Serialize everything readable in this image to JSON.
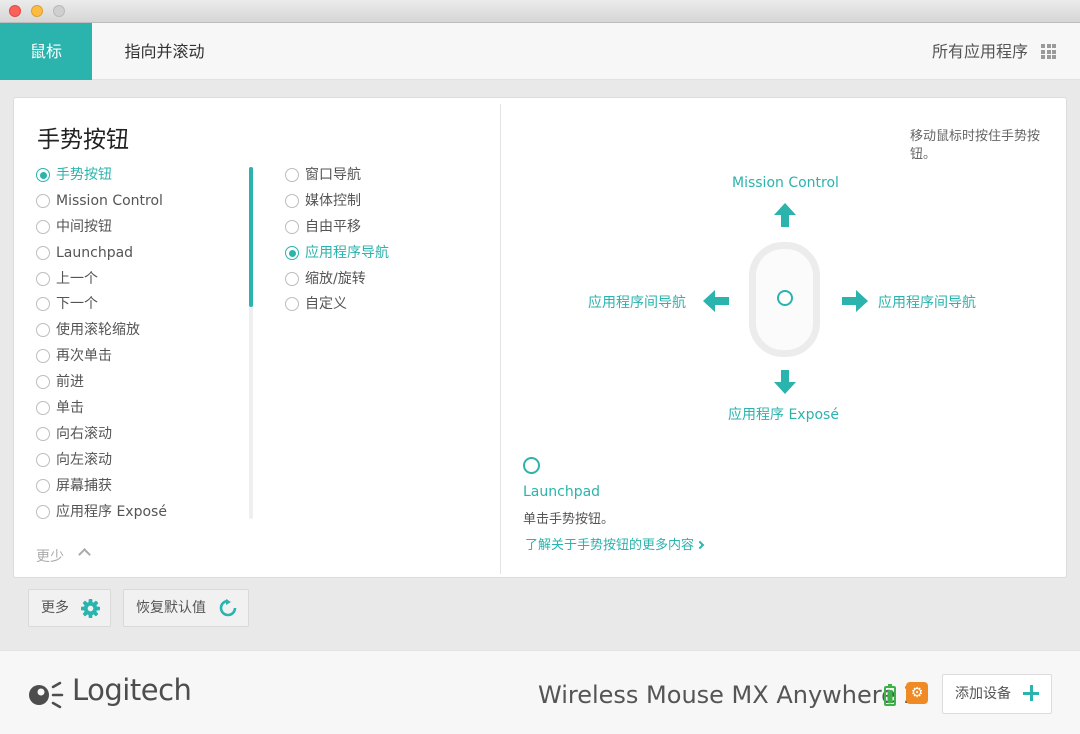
{
  "tabs": [
    {
      "label": "鼠标",
      "active": true
    },
    {
      "label": "指向并滚动",
      "active": false
    }
  ],
  "all_apps_label": "所有应用程序",
  "section_title": "手势按钮",
  "options_col1": [
    {
      "label": "手势按钮",
      "selected": true
    },
    {
      "label": "Mission Control",
      "selected": false
    },
    {
      "label": "中间按钮",
      "selected": false
    },
    {
      "label": "Launchpad",
      "selected": false
    },
    {
      "label": "上一个",
      "selected": false
    },
    {
      "label": "下一个",
      "selected": false
    },
    {
      "label": "使用滚轮缩放",
      "selected": false
    },
    {
      "label": "再次单击",
      "selected": false
    },
    {
      "label": "前进",
      "selected": false
    },
    {
      "label": "单击",
      "selected": false
    },
    {
      "label": "向右滚动",
      "selected": false
    },
    {
      "label": "向左滚动",
      "selected": false
    },
    {
      "label": "屏幕捕获",
      "selected": false
    },
    {
      "label": "应用程序 Exposé",
      "selected": false
    }
  ],
  "options_col2": [
    {
      "label": "窗口导航",
      "selected": false
    },
    {
      "label": "媒体控制",
      "selected": false
    },
    {
      "label": "自由平移",
      "selected": false
    },
    {
      "label": "应用程序导航",
      "selected": true
    },
    {
      "label": "缩放/旋转",
      "selected": false
    },
    {
      "label": "自定义",
      "selected": false
    }
  ],
  "fewer_label": "更少",
  "hint": "移动鼠标时按住手势按钮。",
  "diagram": {
    "up": "Mission Control",
    "left": "应用程序间导航",
    "right": "应用程序间导航",
    "down": "应用程序 Exposé"
  },
  "click_action": {
    "title": "Launchpad",
    "desc": "单击手势按钮。",
    "link": "了解关于手势按钮的更多内容"
  },
  "more_button": "更多",
  "restore_button": "恢复默认值",
  "footer": {
    "brand": "Logitech",
    "device_name": "Wireless Mouse MX Anywhere 2",
    "add_device": "添加设备"
  },
  "icons": {
    "more": "gear-icon",
    "restore": "refresh-icon",
    "apps": "grid-icon",
    "battery": "battery-icon",
    "flow": "flow-icon",
    "add": "plus-icon"
  },
  "colors": {
    "accent": "#2bb3ad",
    "flow": "#f08a24",
    "battery": "#3db24b"
  }
}
